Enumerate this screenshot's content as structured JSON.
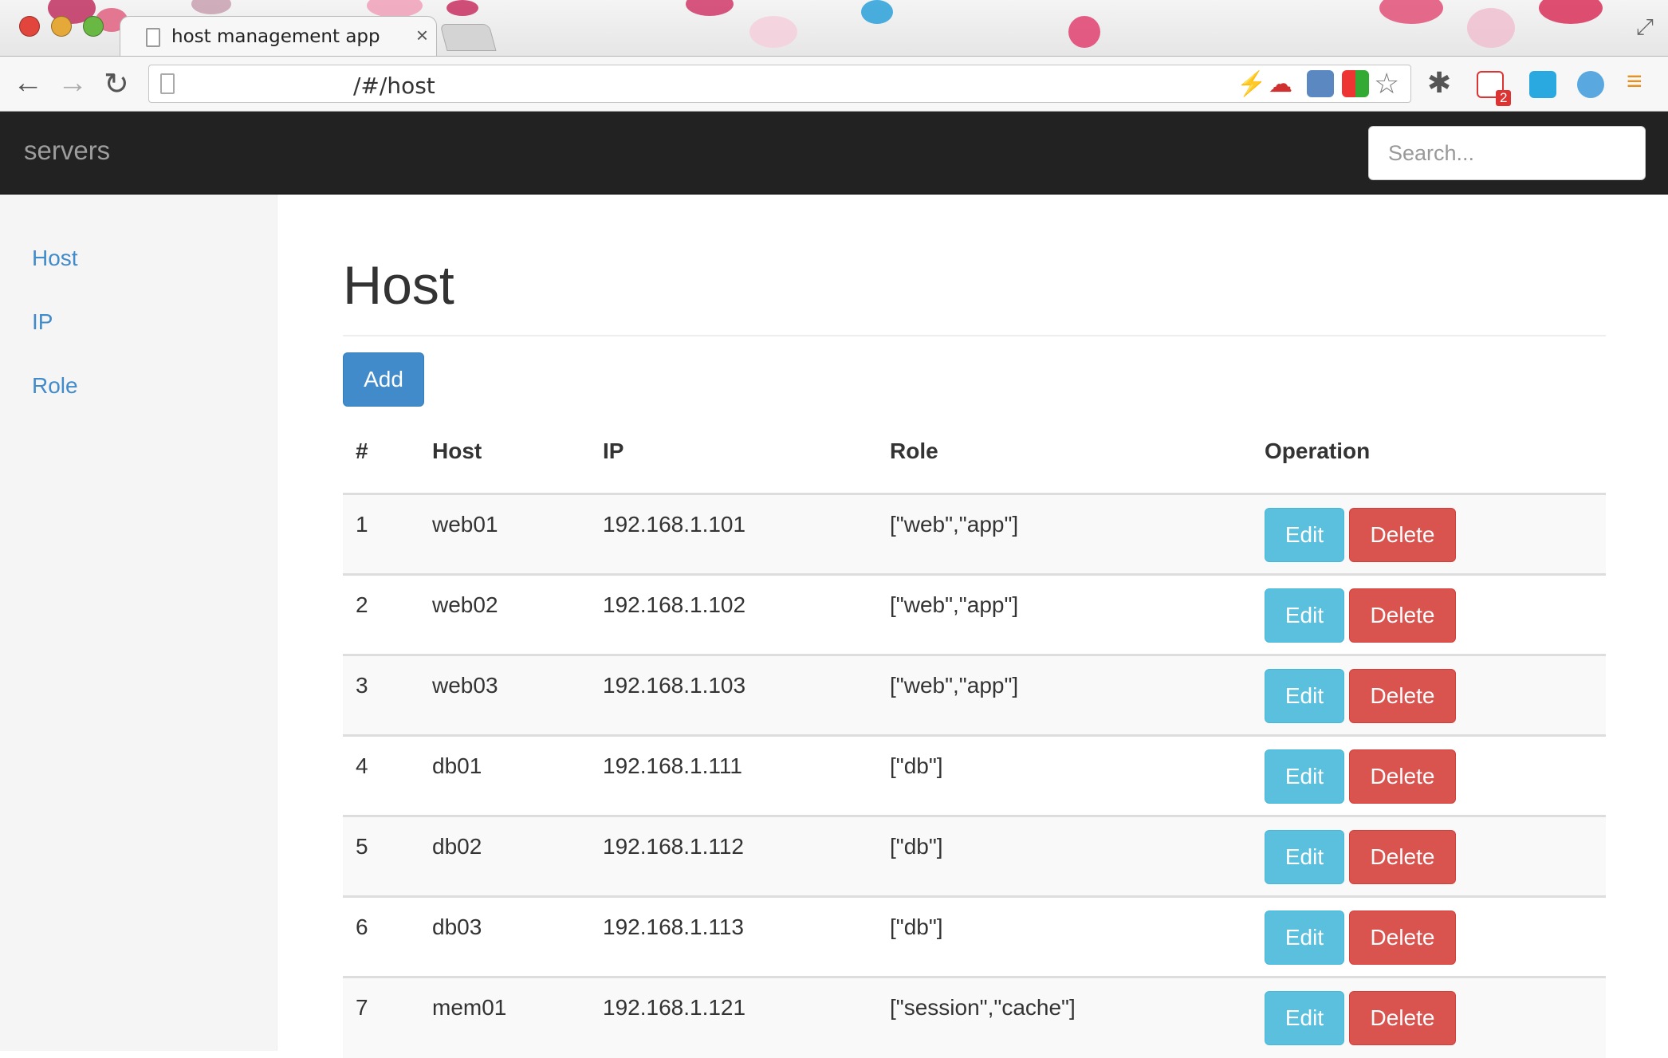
{
  "browser": {
    "tab_title": "host management app",
    "tab_close": "×",
    "url": "/#/host",
    "gmail_badge": "2"
  },
  "app": {
    "brand": "servers",
    "search_placeholder": "Search..."
  },
  "sidebar": {
    "items": [
      {
        "label": "Host"
      },
      {
        "label": "IP"
      },
      {
        "label": "Role"
      }
    ]
  },
  "main": {
    "title": "Host",
    "add_label": "Add",
    "columns": [
      "#",
      "Host",
      "IP",
      "Role",
      "Operation"
    ],
    "edit_label": "Edit",
    "delete_label": "Delete",
    "rows": [
      {
        "num": "1",
        "host": "web01",
        "ip": "192.168.1.101",
        "role": "[\"web\",\"app\"]"
      },
      {
        "num": "2",
        "host": "web02",
        "ip": "192.168.1.102",
        "role": "[\"web\",\"app\"]"
      },
      {
        "num": "3",
        "host": "web03",
        "ip": "192.168.1.103",
        "role": "[\"web\",\"app\"]"
      },
      {
        "num": "4",
        "host": "db01",
        "ip": "192.168.1.111",
        "role": "[\"db\"]"
      },
      {
        "num": "5",
        "host": "db02",
        "ip": "192.168.1.112",
        "role": "[\"db\"]"
      },
      {
        "num": "6",
        "host": "db03",
        "ip": "192.168.1.113",
        "role": "[\"db\"]"
      },
      {
        "num": "7",
        "host": "mem01",
        "ip": "192.168.1.121",
        "role": "[\"session\",\"cache\"]"
      }
    ]
  },
  "colors": {
    "navbar": "#222222",
    "link": "#428bca",
    "primary": "#428bca",
    "info": "#5bc0de",
    "danger": "#d9534f"
  }
}
